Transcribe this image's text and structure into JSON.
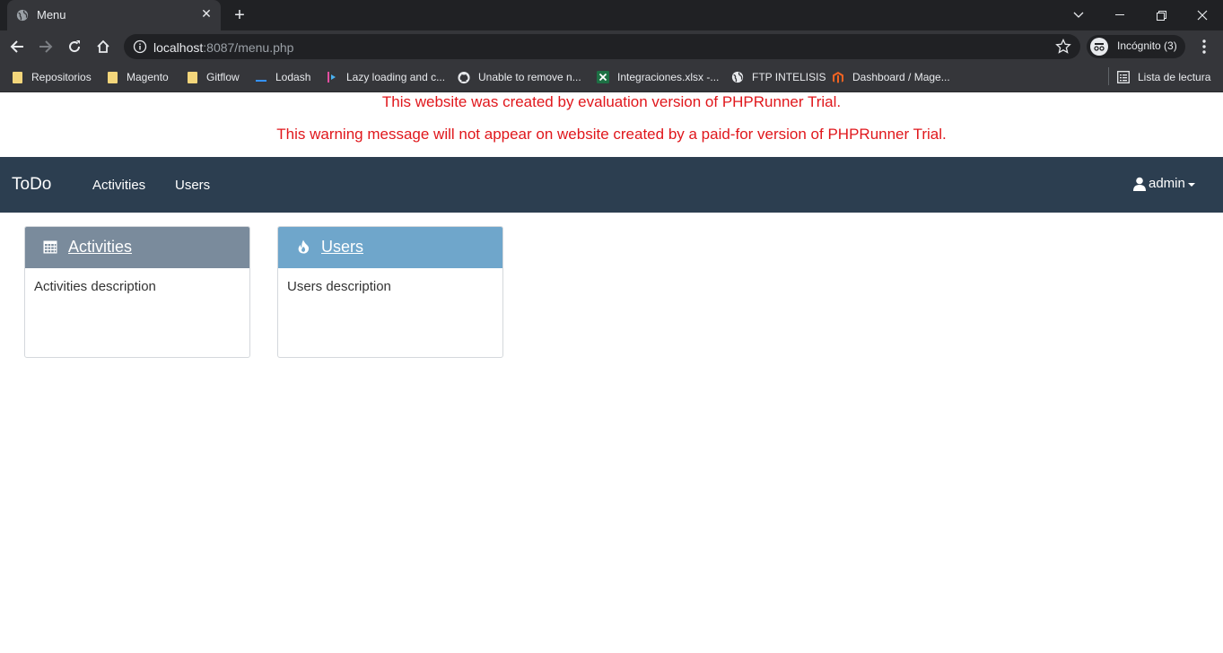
{
  "browser": {
    "tab_title": "Menu",
    "url_host": "localhost",
    "url_rest": ":8087/menu.php",
    "profile_label": "Incógnito (3)",
    "bookmarks": [
      {
        "label": "Repositorios",
        "icon": "folder-icon"
      },
      {
        "label": "Magento",
        "icon": "folder-icon"
      },
      {
        "label": "Gitflow",
        "icon": "folder-icon"
      },
      {
        "label": "Lodash",
        "icon": "lodash-icon"
      },
      {
        "label": "Lazy loading and c...",
        "icon": "lazy-loading-icon"
      },
      {
        "label": "Unable to remove n...",
        "icon": "github-icon"
      },
      {
        "label": "Integraciones.xlsx -...",
        "icon": "excel-icon"
      },
      {
        "label": "FTP INTELISIS",
        "icon": "globe-icon"
      },
      {
        "label": "Dashboard / Mage...",
        "icon": "magento-icon"
      }
    ],
    "reading_list": "Lista de lectura"
  },
  "page": {
    "trial_line1": "This website was created by evaluation version of PHPRunner Trial.",
    "trial_line2": "This warning message will not appear on website created by a paid-for version of PHPRunner Trial.",
    "navbar": {
      "brand": "ToDo",
      "links": [
        "Activities",
        "Users"
      ],
      "user": "admin"
    },
    "cards": [
      {
        "title": "Activities",
        "description": "Activities description",
        "icon": "calendar-icon",
        "color": "#7a8b9c"
      },
      {
        "title": "Users",
        "description": "Users description",
        "icon": "fire-icon",
        "color": "#6fa6cb"
      }
    ]
  },
  "colors": {
    "warning_red": "#e0171c",
    "navbar_bg": "#2c3e50"
  }
}
